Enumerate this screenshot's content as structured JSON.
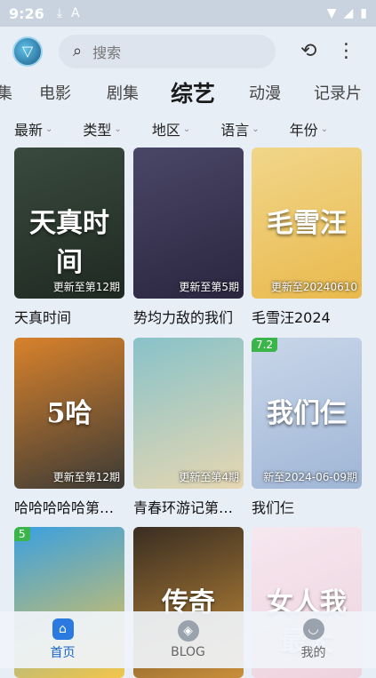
{
  "status": {
    "time": "9:26",
    "icons": [
      "download-icon",
      "font-icon"
    ],
    "right": [
      "wifi-icon",
      "signal-icon",
      "battery-icon"
    ]
  },
  "search": {
    "placeholder": "搜索"
  },
  "categories": [
    {
      "label": "集",
      "active": false
    },
    {
      "label": "电影",
      "active": false
    },
    {
      "label": "剧集",
      "active": false
    },
    {
      "label": "综艺",
      "active": true
    },
    {
      "label": "动漫",
      "active": false
    },
    {
      "label": "记录片",
      "active": false
    }
  ],
  "filters": [
    "最新",
    "类型",
    "地区",
    "语言",
    "年份"
  ],
  "items": [
    {
      "title": "天真时间",
      "episode": "更新至第12期",
      "rating": "",
      "poster_text": "天真时间",
      "colors": [
        "#3a4a3e",
        "#1f2a22"
      ]
    },
    {
      "title": "势均力敌的我们",
      "episode": "更新至第5期",
      "rating": "",
      "poster_text": "",
      "colors": [
        "#4a4666",
        "#2a2640"
      ]
    },
    {
      "title": "毛雪汪2024",
      "episode": "更新至20240610",
      "rating": "",
      "poster_text": "毛雪汪",
      "colors": [
        "#f1d68a",
        "#e9b94d"
      ]
    },
    {
      "title": "哈哈哈哈哈第…",
      "episode": "更新至第12期",
      "rating": "",
      "poster_text": "5哈",
      "colors": [
        "#d9822b",
        "#3b3a36"
      ]
    },
    {
      "title": "青春环游记第…",
      "episode": "更新至第4期",
      "rating": "",
      "poster_text": "",
      "colors": [
        "#88c2c9",
        "#e6d7b2"
      ]
    },
    {
      "title": "我们仨",
      "episode": "新至2024-06-09期",
      "rating": "7.2",
      "poster_text": "我们仨",
      "colors": [
        "#c9d6e9",
        "#9fb6d6"
      ]
    },
    {
      "title": "",
      "episode": "",
      "rating": "5",
      "poster_text": "",
      "colors": [
        "#3aa0e0",
        "#f3c64a"
      ]
    },
    {
      "title": "",
      "episode": "",
      "rating": "",
      "poster_text": "传奇",
      "colors": [
        "#3a2e22",
        "#c98f3a"
      ]
    },
    {
      "title": "",
      "episode": "",
      "rating": "",
      "poster_text": "女人我最大",
      "colors": [
        "#f6e7ef",
        "#eed3de"
      ]
    }
  ],
  "tabs": [
    {
      "label": "首页",
      "icon": "home-icon",
      "active": true
    },
    {
      "label": "BLOG",
      "icon": "compass-icon",
      "active": false
    },
    {
      "label": "我的",
      "icon": "profile-icon",
      "active": false
    }
  ]
}
